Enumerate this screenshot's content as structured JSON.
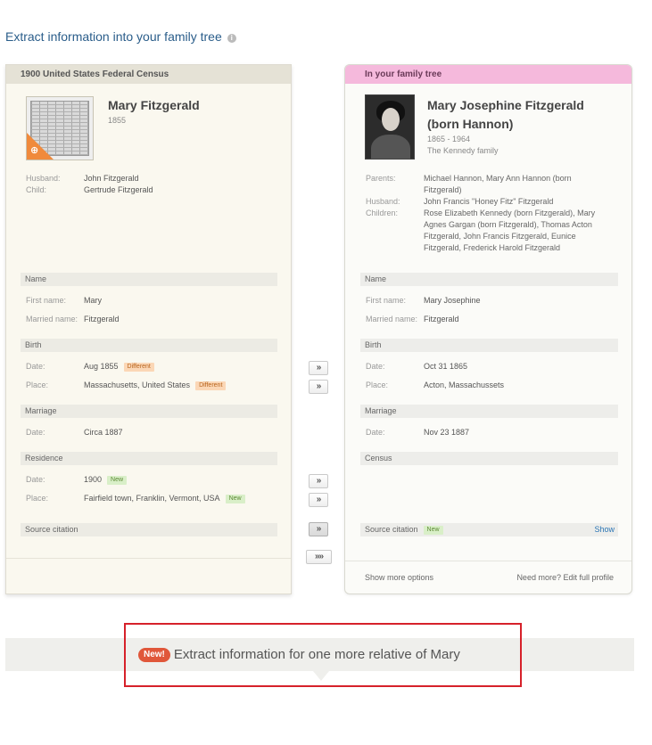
{
  "page": {
    "title": "Extract information into your family tree",
    "info_glyph": "i"
  },
  "left_panel": {
    "header": "1900 United States Federal Census",
    "zoom_glyph": "⊕",
    "person": {
      "name": "Mary Fitzgerald",
      "years": "1855"
    },
    "relatives": [
      {
        "label": "Husband:",
        "value": "John Fitzgerald"
      },
      {
        "label": "Child:",
        "value": "Gertrude Fitzgerald"
      }
    ],
    "sections": {
      "name": "Name",
      "birth": "Birth",
      "marriage": "Marriage",
      "residence": "Residence",
      "source": "Source citation"
    },
    "fields": {
      "first_name": {
        "label": "First name:",
        "value": "Mary"
      },
      "married_name": {
        "label": "Married name:",
        "value": "Fitzgerald"
      },
      "birth_date": {
        "label": "Date:",
        "value": "Aug 1855",
        "badge": "Different"
      },
      "birth_place": {
        "label": "Place:",
        "value": "Massachusetts, United States",
        "badge": "Different"
      },
      "marriage_date": {
        "label": "Date:",
        "value": "Circa 1887"
      },
      "residence_date": {
        "label": "Date:",
        "value": "1900",
        "badge": "New"
      },
      "residence_place": {
        "label": "Place:",
        "value": "Fairfield town, Franklin, Vermont, USA",
        "badge": "New"
      }
    }
  },
  "right_panel": {
    "header": "In your family tree",
    "person": {
      "name_line1": "Mary Josephine Fitzgerald",
      "name_line2": "(born Hannon)",
      "years": "1865 - 1964",
      "family": "The Kennedy family"
    },
    "relatives": {
      "parents": {
        "label": "Parents:",
        "lines": [
          "Michael Hannon, Mary Ann Hannon (born",
          "Fitzgerald)"
        ]
      },
      "husband": {
        "label": "Husband:",
        "lines": [
          "John Francis \"Honey Fitz\" Fitzgerald"
        ]
      },
      "children": {
        "label": "Children:",
        "lines": [
          "Rose Elizabeth Kennedy (born Fitzgerald), Mary",
          "Agnes Gargan (born Fitzgerald), Thomas Acton",
          "Fitzgerald, John Francis Fitzgerald, Eunice",
          "Fitzgerald, Frederick Harold Fitzgerald"
        ]
      }
    },
    "sections": {
      "name": "Name",
      "birth": "Birth",
      "marriage": "Marriage",
      "census": "Census",
      "source": "Source citation"
    },
    "source_badge": "New",
    "show_label": "Show",
    "fields": {
      "first_name": {
        "label": "First name:",
        "value": "Mary Josephine"
      },
      "married_name": {
        "label": "Married name:",
        "value": "Fitzgerald"
      },
      "birth_date": {
        "label": "Date:",
        "value": "Oct 31 1865"
      },
      "birth_place": {
        "label": "Place:",
        "value": "Acton, Massachussets"
      },
      "marriage_date": {
        "label": "Date:",
        "value": "Nov 23 1887"
      }
    },
    "footer": {
      "more_options": "Show more options",
      "edit_profile": "Need more? Edit full profile"
    }
  },
  "transfer_buttons": {
    "single": "»",
    "all": "»»"
  },
  "cta": {
    "badge": "New!",
    "text": "Extract information for one more relative of Mary"
  },
  "colors": {
    "accent_orange": "#f08a3c",
    "tree_header_pink": "#f5b9dc",
    "highlight_red": "#d6212a",
    "link_blue": "#2a75b5"
  }
}
